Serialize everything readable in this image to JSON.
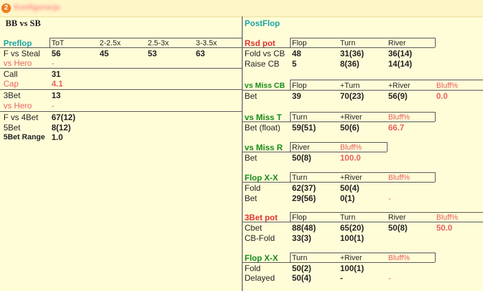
{
  "window": {
    "badge": "2",
    "title": "Konfiguracja"
  },
  "left": {
    "title": "BB vs SB",
    "preflop_label": "Preflop",
    "col_headers": [
      "ToT",
      "2-2.5x",
      "2.5-3x",
      "3-3.5x"
    ],
    "f_vs_steal": {
      "label": "F vs Steal",
      "values": [
        "56",
        "45",
        "53",
        "63"
      ]
    },
    "vs_hero_1": {
      "label": "vs Hero",
      "value": "-"
    },
    "call": {
      "label": "Call",
      "value": "31"
    },
    "cap": {
      "label": "Cap",
      "value": "4.1"
    },
    "threebet": {
      "label": "3Bet",
      "value": "13"
    },
    "vs_hero_2": {
      "label": "vs Hero",
      "value": "-"
    },
    "f_vs_4bet": {
      "label": "F vs 4Bet",
      "value": "67(12)"
    },
    "fivebet": {
      "label": "5Bet",
      "value": "8(12)"
    },
    "fivebet_range": {
      "label": "5Bet Range",
      "value": "1.0"
    }
  },
  "right": {
    "title": "PostFlop",
    "rsd_pot": {
      "label": "Rsd pot",
      "headers": [
        "Flop",
        "Turn",
        "River"
      ],
      "rows": [
        {
          "label": "Fold vs CB",
          "values": [
            "48",
            "31(36)",
            "36(14)"
          ]
        },
        {
          "label": "Raise CB",
          "values": [
            "5",
            "8(36)",
            "14(14)"
          ]
        }
      ]
    },
    "vs_miss_cb": {
      "label": "vs Miss CB",
      "headers": [
        "Flop",
        "+Turn",
        "+River",
        "Bluff%"
      ],
      "row": {
        "label": "Bet",
        "values": [
          "39",
          "70(23)",
          "56(9)",
          "0.0"
        ]
      }
    },
    "vs_miss_t": {
      "label": "vs Miss T",
      "headers": [
        "Turn",
        "+River",
        "Bluff%"
      ],
      "row": {
        "label": "Bet (float)",
        "values": [
          "59(51)",
          "50(6)",
          "66.7"
        ]
      }
    },
    "vs_miss_r": {
      "label": "vs Miss R",
      "headers": [
        "River",
        "Bluff%"
      ],
      "row": {
        "label": "Bet",
        "values": [
          "50(8)",
          "100.0"
        ]
      }
    },
    "flop_xx_1": {
      "label": "Flop X-X",
      "headers": [
        "Turn",
        "+River",
        "Bluff%"
      ],
      "rows": [
        {
          "label": "Fold",
          "values": [
            "62(37)",
            "50(4)",
            ""
          ]
        },
        {
          "label": "Bet",
          "values": [
            "29(56)",
            "0(1)",
            "-"
          ]
        }
      ]
    },
    "threebet_pot": {
      "label": "3Bet pot",
      "headers": [
        "Flop",
        "Turn",
        "River",
        "Bluff%"
      ],
      "rows": [
        {
          "label": "Cbet",
          "values": [
            "88(48)",
            "65(20)",
            "50(8)",
            "50.0"
          ]
        },
        {
          "label": "CB-Fold",
          "values": [
            "33(3)",
            "100(1)",
            "",
            ""
          ]
        }
      ]
    },
    "flop_xx_2": {
      "label": "Flop X-X",
      "headers": [
        "Turn",
        "+River",
        "Bluff%"
      ],
      "rows": [
        {
          "label": "Fold",
          "values": [
            "50(2)",
            "100(1)",
            ""
          ]
        },
        {
          "label": "Delayed",
          "values": [
            "50(4)",
            "-",
            "-"
          ]
        }
      ]
    }
  }
}
